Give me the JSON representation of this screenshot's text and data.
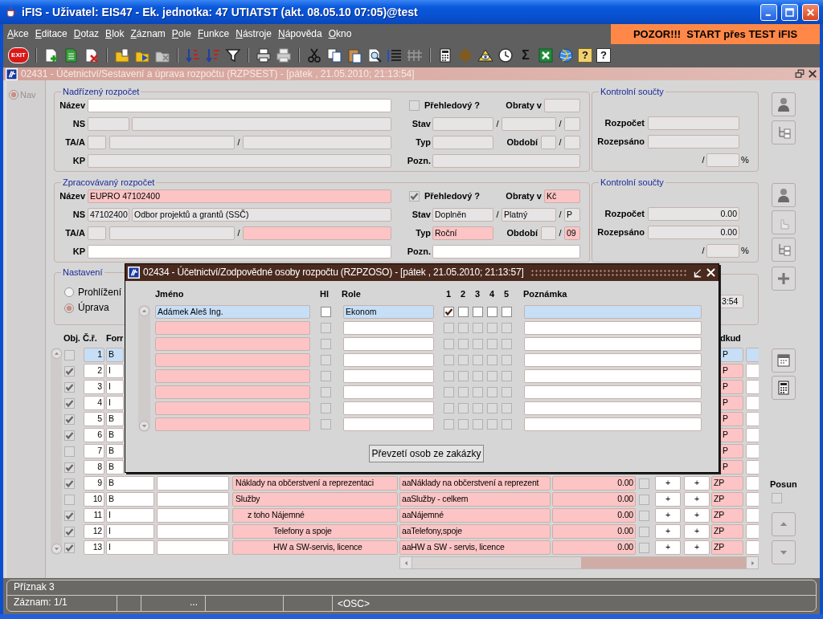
{
  "window": {
    "title": "iFIS - Uživatel: EIS47 - Ek. jednotka: 47 UTIATST (akt. 08.05.10 07:05)@test"
  },
  "menu": [
    {
      "label": "Akce"
    },
    {
      "label": "Editace"
    },
    {
      "label": "Dotaz"
    },
    {
      "label": "Blok"
    },
    {
      "label": "Záznam"
    },
    {
      "label": "Pole"
    },
    {
      "label": "Funkce"
    },
    {
      "label": "Nástroje"
    },
    {
      "label": "Nápověda"
    },
    {
      "label": "Okno"
    }
  ],
  "banner": "POZOR!!!  START přes TEST iFIS",
  "toolbar": [
    {
      "kind": "exit",
      "text": "EXIT"
    },
    {
      "kind": "sep"
    },
    {
      "kind": "doc-plus"
    },
    {
      "kind": "doc-lines"
    },
    {
      "kind": "doc-cross"
    },
    {
      "kind": "sep"
    },
    {
      "kind": "folder-doc"
    },
    {
      "kind": "folder-play"
    },
    {
      "kind": "folder-cross"
    },
    {
      "kind": "sep"
    },
    {
      "kind": "sort-a"
    },
    {
      "kind": "sort-b"
    },
    {
      "kind": "filter"
    },
    {
      "kind": "sep"
    },
    {
      "kind": "printer"
    },
    {
      "kind": "printer-dim"
    },
    {
      "kind": "sep"
    },
    {
      "kind": "scissors"
    },
    {
      "kind": "copy"
    },
    {
      "kind": "paste"
    },
    {
      "kind": "search"
    },
    {
      "kind": "list"
    },
    {
      "kind": "columns"
    },
    {
      "kind": "sep"
    },
    {
      "kind": "calculator"
    },
    {
      "kind": "wheel"
    },
    {
      "kind": "eye"
    },
    {
      "kind": "clock"
    },
    {
      "kind": "sum",
      "text": "Σ"
    },
    {
      "kind": "sheet"
    },
    {
      "kind": "globe"
    },
    {
      "kind": "help-key",
      "text": "?"
    },
    {
      "kind": "help",
      "text": "?"
    }
  ],
  "form_window": {
    "title": "02431 - Účetnictví/Sestavení a úprava rozpočtu (RZPSEST) - [pátek , 21.05.2010; 21:13:54]"
  },
  "nav": {
    "label": "Nav",
    "selected": true
  },
  "budget_sections": [
    {
      "legend": "Nadřízený rozpočet",
      "rows": [
        [
          {
            "kind": "group",
            "label": "Název",
            "inputs": [
              {
                "kind": "field",
                "required": false,
                "disabled": false
              }
            ]
          },
          {
            "kind": "check",
            "label": "Přehledový ?",
            "checked": false
          },
          {
            "kind": "group",
            "label": "Obraty v",
            "inputs": [
              {
                "kind": "field",
                "required": false,
                "disabled": true
              }
            ]
          }
        ],
        [
          {
            "kind": "group",
            "label": "NS",
            "inputs": [
              {
                "kind": "field",
                "required": false,
                "disabled": true
              },
              {
                "kind": "field",
                "required": false,
                "disabled": true
              }
            ]
          },
          {
            "kind": "group",
            "label": "Stav",
            "inputs": [
              {
                "kind": "field",
                "required": false,
                "disabled": true
              },
              {
                "kind": "sep",
                "text": "/"
              },
              {
                "kind": "field",
                "required": false,
                "disabled": true
              },
              {
                "kind": "sep",
                "text": "/"
              },
              {
                "kind": "field",
                "required": false,
                "disabled": true
              }
            ]
          }
        ],
        [
          {
            "kind": "group",
            "label": "TA/A",
            "inputs": [
              {
                "kind": "field",
                "required": false,
                "disabled": true
              },
              {
                "kind": "field",
                "required": false,
                "disabled": true
              },
              {
                "kind": "sep",
                "text": "/"
              },
              {
                "kind": "field",
                "required": false,
                "disabled": true
              }
            ]
          },
          {
            "kind": "group",
            "label": "Typ",
            "inputs": [
              {
                "kind": "field",
                "required": false,
                "disabled": true
              }
            ]
          },
          {
            "kind": "group",
            "label": "Období",
            "inputs": [
              {
                "kind": "field",
                "required": false,
                "disabled": true
              },
              {
                "kind": "sep",
                "text": "/"
              },
              {
                "kind": "field",
                "required": false,
                "disabled": true
              }
            ]
          }
        ],
        [
          {
            "kind": "group",
            "label": "KP",
            "inputs": [
              {
                "kind": "field",
                "required": false,
                "disabled": true
              }
            ]
          },
          {
            "kind": "group",
            "label": "Pozn.",
            "inputs": [
              {
                "kind": "field",
                "required": false,
                "disabled": true
              }
            ]
          }
        ]
      ],
      "totals": {
        "legend": "Kontrolní součty",
        "rows": [
          [
            {
              "kind": "group",
              "label": "Rozpočet",
              "inputs": [
                {
                  "kind": "field",
                  "required": false,
                  "disabled": true
                }
              ]
            }
          ],
          [
            {
              "kind": "group",
              "label": "Rozepsáno",
              "inputs": [
                {
                  "kind": "field",
                  "required": false,
                  "disabled": true
                }
              ]
            }
          ],
          [
            {
              "kind": "group",
              "inputs": [
                {
                  "kind": "sep",
                  "text": "/"
                },
                {
                  "kind": "field",
                  "required": false,
                  "disabled": true
                },
                {
                  "kind": "sep",
                  "text": "%"
                }
              ]
            }
          ]
        ]
      }
    },
    {
      "legend": "Zpracovávaný rozpočet",
      "rows": [
        [
          {
            "kind": "group",
            "label": "Název",
            "inputs": [
              {
                "kind": "field",
                "value": "EUPRO 47102400",
                "required": true,
                "disabled": false
              }
            ]
          },
          {
            "kind": "check",
            "label": "Přehledový ?",
            "checked": true
          },
          {
            "kind": "group",
            "label": "Obraty v",
            "inputs": [
              {
                "kind": "field",
                "value": "Kč",
                "required": true,
                "disabled": false
              }
            ]
          }
        ],
        [
          {
            "kind": "group",
            "label": "NS",
            "inputs": [
              {
                "kind": "field",
                "value": "47102400",
                "required": false,
                "disabled": true
              },
              {
                "kind": "field",
                "value": "Odbor projektů a grantů (SSČ)",
                "required": false,
                "disabled": true
              }
            ]
          },
          {
            "kind": "group",
            "label": "Stav",
            "inputs": [
              {
                "kind": "field",
                "value": "Doplněn",
                "required": false,
                "disabled": true
              },
              {
                "kind": "sep",
                "text": "/"
              },
              {
                "kind": "field",
                "value": "Platný",
                "required": false,
                "disabled": true
              },
              {
                "kind": "sep",
                "text": "/"
              },
              {
                "kind": "field",
                "value": "P",
                "required": false,
                "disabled": true
              }
            ]
          }
        ],
        [
          {
            "kind": "group",
            "label": "TA/A",
            "inputs": [
              {
                "kind": "field",
                "required": false,
                "disabled": true
              },
              {
                "kind": "field",
                "required": false,
                "disabled": true
              },
              {
                "kind": "sep",
                "text": "/"
              },
              {
                "kind": "field",
                "required": true,
                "disabled": false
              }
            ]
          },
          {
            "kind": "group",
            "label": "Typ",
            "inputs": [
              {
                "kind": "field",
                "value": "Roční",
                "required": true,
                "disabled": false
              }
            ]
          },
          {
            "kind": "group",
            "label": "Období",
            "inputs": [
              {
                "kind": "field",
                "required": false,
                "disabled": true
              },
              {
                "kind": "sep",
                "text": "/"
              },
              {
                "kind": "field",
                "value": "09",
                "required": true,
                "disabled": false
              }
            ]
          }
        ],
        [
          {
            "kind": "group",
            "label": "KP",
            "inputs": [
              {
                "kind": "field",
                "required": false,
                "disabled": false
              }
            ]
          },
          {
            "kind": "group",
            "label": "Pozn.",
            "inputs": [
              {
                "kind": "field",
                "required": false,
                "disabled": false
              }
            ]
          }
        ]
      ],
      "totals": {
        "legend": "Kontrolní součty",
        "rows": [
          [
            {
              "kind": "group",
              "label": "Rozpočet",
              "inputs": [
                {
                  "kind": "field",
                  "value": "0.00",
                  "required": false,
                  "disabled": true
                }
              ]
            }
          ],
          [
            {
              "kind": "group",
              "label": "Rozepsáno",
              "inputs": [
                {
                  "kind": "field",
                  "value": "0.00",
                  "required": false,
                  "disabled": true
                }
              ]
            }
          ],
          [
            {
              "kind": "group",
              "inputs": [
                {
                  "kind": "sep",
                  "text": "/"
                },
                {
                  "kind": "field",
                  "required": false,
                  "disabled": true
                },
                {
                  "kind": "sep",
                  "text": "%"
                }
              ]
            }
          ]
        ]
      }
    }
  ],
  "settings": {
    "legend": "Nastavení",
    "options": [
      {
        "label": "Prohlížení",
        "selected": false
      },
      {
        "label": "Úprava",
        "selected": true
      }
    ]
  },
  "partial_field": {
    "value": "3:54"
  },
  "table": {
    "columns": [
      {
        "label": "Obj."
      },
      {
        "label": "Č.ř."
      },
      {
        "label": "Forr"
      },
      {
        "label": "dkud"
      }
    ],
    "rows": [
      {
        "kind": "covered",
        "selected": true,
        "checked": false,
        "number": "1",
        "form": "B",
        "code": "P"
      },
      {
        "kind": "covered",
        "selected": false,
        "checked": true,
        "number": "2",
        "form": "I",
        "code": "P"
      },
      {
        "kind": "covered",
        "selected": false,
        "checked": true,
        "number": "3",
        "form": "I",
        "code": "P"
      },
      {
        "kind": "covered",
        "selected": false,
        "checked": true,
        "number": "4",
        "form": "I",
        "code": "P"
      },
      {
        "kind": "covered",
        "selected": false,
        "checked": true,
        "number": "5",
        "form": "B",
        "code": "P"
      },
      {
        "kind": "covered",
        "selected": false,
        "checked": true,
        "number": "6",
        "form": "B",
        "code": "P"
      },
      {
        "kind": "covered",
        "selected": false,
        "checked": false,
        "number": "7",
        "form": "B",
        "code": "P"
      },
      {
        "kind": "covered",
        "selected": false,
        "checked": true,
        "number": "8",
        "form": "B",
        "code": "P"
      },
      {
        "kind": "total",
        "selected": false,
        "checked": true,
        "number": "9",
        "form": "B",
        "name": "Náklady na občerstvení a reprezentaci",
        "account": "aaNáklady na občerstvení a reprezent",
        "amount": "0.00",
        "flag": false,
        "add_a": "+",
        "add_b": "+",
        "code": "ZP"
      },
      {
        "kind": "total",
        "selected": false,
        "checked": false,
        "number": "10",
        "form": "B",
        "name": "Služby",
        "account": "aaSlužby - celkem",
        "amount": "0.00",
        "flag": false,
        "add_a": "+",
        "add_b": "+",
        "code": "ZP"
      },
      {
        "kind": "part",
        "selected": false,
        "checked": true,
        "number": "11",
        "form": "I",
        "name": "z toho Nájemné",
        "account": "aaNájemné",
        "amount": "0.00",
        "flag": false,
        "add_a": "+",
        "add_b": "+",
        "code": "ZP"
      },
      {
        "kind": "detail",
        "selected": false,
        "checked": true,
        "number": "12",
        "form": "I",
        "name": "Telefony a spoje",
        "account": "aaTelefony,spoje",
        "amount": "0.00",
        "flag": false,
        "add_a": "+",
        "add_b": "+",
        "code": "ZP"
      },
      {
        "kind": "detail",
        "selected": false,
        "checked": true,
        "number": "13",
        "form": "I",
        "name": "HW a SW-servis, licence",
        "account": "aaHW a SW - servis, licence",
        "amount": "0.00",
        "flag": false,
        "add_a": "+",
        "add_b": "+",
        "code": "ZP"
      }
    ]
  },
  "shift": {
    "label": "Posun",
    "checked": false
  },
  "dialog": {
    "title": "02434 - Účetnictví/Zodpovědné osoby rozpočtu (RZPZOSO) - [pátek , 21.05.2010; 21:13:57]",
    "columns": [
      {
        "label": "Jméno"
      },
      {
        "label": "Hl"
      },
      {
        "label": "Role"
      },
      {
        "label": "1"
      },
      {
        "label": "2"
      },
      {
        "label": "3"
      },
      {
        "label": "4"
      },
      {
        "label": "5"
      },
      {
        "label": "Poznámka"
      }
    ],
    "rows": [
      {
        "selected": true,
        "disabled": false,
        "name": "Adámek Aleš Ing.",
        "primary": false,
        "role": "Ekonom",
        "flags": [
          {
            "checked": true
          },
          {
            "checked": false
          },
          {
            "checked": false
          },
          {
            "checked": false
          },
          {
            "checked": false
          }
        ]
      },
      {
        "selected": false,
        "disabled": true,
        "primary": false,
        "flags": [
          {
            "checked": false
          },
          {
            "checked": false
          },
          {
            "checked": false
          },
          {
            "checked": false
          },
          {
            "checked": false
          }
        ]
      },
      {
        "selected": false,
        "disabled": true,
        "primary": false,
        "flags": [
          {
            "checked": false
          },
          {
            "checked": false
          },
          {
            "checked": false
          },
          {
            "checked": false
          },
          {
            "checked": false
          }
        ]
      },
      {
        "selected": false,
        "disabled": true,
        "primary": false,
        "flags": [
          {
            "checked": false
          },
          {
            "checked": false
          },
          {
            "checked": false
          },
          {
            "checked": false
          },
          {
            "checked": false
          }
        ]
      },
      {
        "selected": false,
        "disabled": true,
        "primary": false,
        "flags": [
          {
            "checked": false
          },
          {
            "checked": false
          },
          {
            "checked": false
          },
          {
            "checked": false
          },
          {
            "checked": false
          }
        ]
      },
      {
        "selected": false,
        "disabled": true,
        "primary": false,
        "flags": [
          {
            "checked": false
          },
          {
            "checked": false
          },
          {
            "checked": false
          },
          {
            "checked": false
          },
          {
            "checked": false
          }
        ]
      },
      {
        "selected": false,
        "disabled": true,
        "primary": false,
        "flags": [
          {
            "checked": false
          },
          {
            "checked": false
          },
          {
            "checked": false
          },
          {
            "checked": false
          },
          {
            "checked": false
          }
        ]
      },
      {
        "selected": false,
        "disabled": true,
        "primary": false,
        "flags": [
          {
            "checked": false
          },
          {
            "checked": false
          },
          {
            "checked": false
          },
          {
            "checked": false
          },
          {
            "checked": false
          }
        ]
      }
    ],
    "button": "Převzetí osob ze zakázky"
  },
  "status_bar": {
    "message": "Příznak 3",
    "record": "Záznam: 1/1",
    "ellipsis": "...",
    "mode": "<OSC>"
  }
}
